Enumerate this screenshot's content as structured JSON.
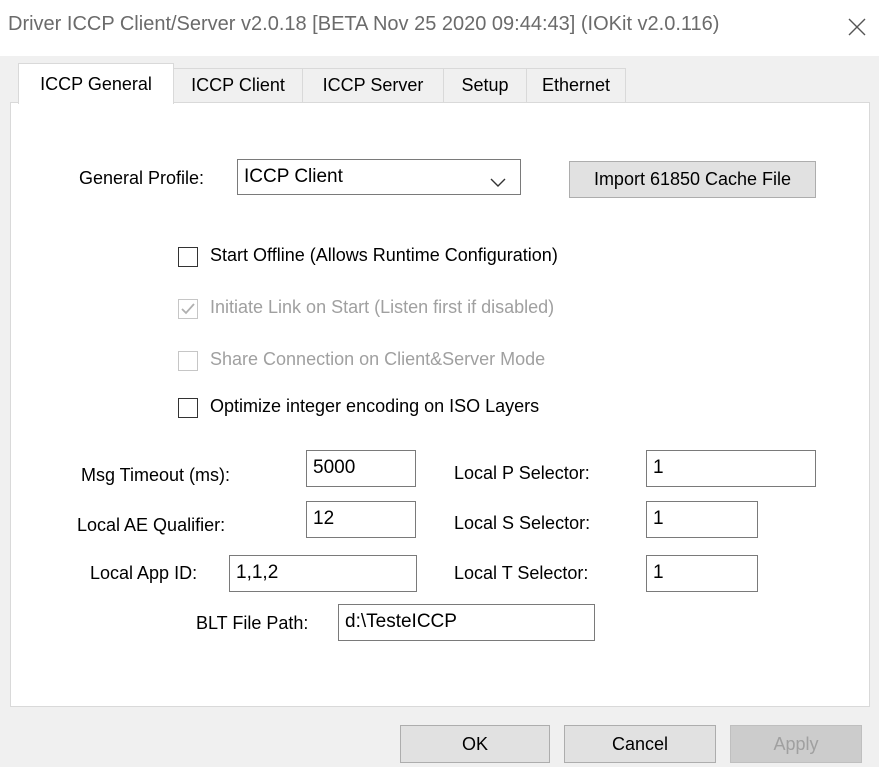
{
  "window": {
    "title": "Driver ICCP Client/Server v2.0.18 [BETA Nov 25 2020 09:44:43] (IOKit v2.0.116)",
    "close_icon": "close-icon"
  },
  "tabs": [
    {
      "label": "ICCP General",
      "active": true
    },
    {
      "label": "ICCP Client",
      "active": false
    },
    {
      "label": "ICCP Server",
      "active": false
    },
    {
      "label": "Setup",
      "active": false
    },
    {
      "label": "Ethernet",
      "active": false
    }
  ],
  "general": {
    "profile_label": "General Profile:",
    "profile_value": "ICCP Client",
    "import_button": "Import 61850 Cache File"
  },
  "checkboxes": [
    {
      "label": "Start Offline (Allows Runtime Configuration)",
      "checked": false,
      "enabled": true
    },
    {
      "label": "Initiate Link on Start (Listen first if disabled)",
      "checked": true,
      "enabled": false
    },
    {
      "label": "Share Connection on Client&Server Mode",
      "checked": false,
      "enabled": false
    },
    {
      "label": "Optimize integer encoding on ISO Layers",
      "checked": false,
      "enabled": true
    }
  ],
  "fields": {
    "msg_timeout": {
      "label": "Msg Timeout (ms):",
      "value": "5000"
    },
    "local_ae_qualifier": {
      "label": "Local AE Qualifier:",
      "value": "12"
    },
    "local_app_id": {
      "label": "Local App ID:",
      "value": "1,1,2"
    },
    "local_p_selector": {
      "label": "Local P Selector:",
      "value": "1"
    },
    "local_s_selector": {
      "label": "Local S Selector:",
      "value": "1"
    },
    "local_t_selector": {
      "label": "Local T Selector:",
      "value": "1"
    },
    "blt_file_path": {
      "label": "BLT File Path:",
      "value": "d:\\TesteICCP"
    }
  },
  "footer": {
    "ok": "OK",
    "cancel": "Cancel",
    "apply": "Apply"
  }
}
